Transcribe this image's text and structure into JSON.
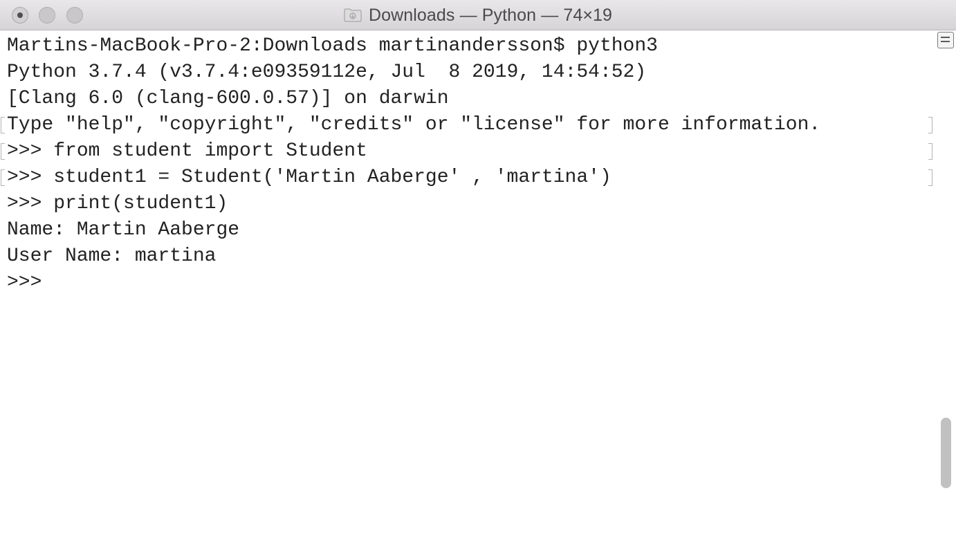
{
  "window": {
    "title": "Downloads — Python — 74×19",
    "title_icon": "folder-icon"
  },
  "terminal": {
    "lines": [
      "Martins-MacBook-Pro-2:Downloads martinandersson$ python3",
      "Python 3.7.4 (v3.7.4:e09359112e, Jul  8 2019, 14:54:52)",
      "[Clang 6.0 (clang-600.0.57)] on darwin",
      "Type \"help\", \"copyright\", \"credits\" or \"license\" for more information.",
      ">>> from student import Student",
      ">>> student1 = Student('Martin Aaberge' , 'martina')",
      ">>> print(student1)",
      "Name: Martin Aaberge",
      "User Name: martina",
      ">>> "
    ]
  },
  "colors": {
    "text": "#222222",
    "background": "#ffffff",
    "titlebar": "#dedcde"
  }
}
